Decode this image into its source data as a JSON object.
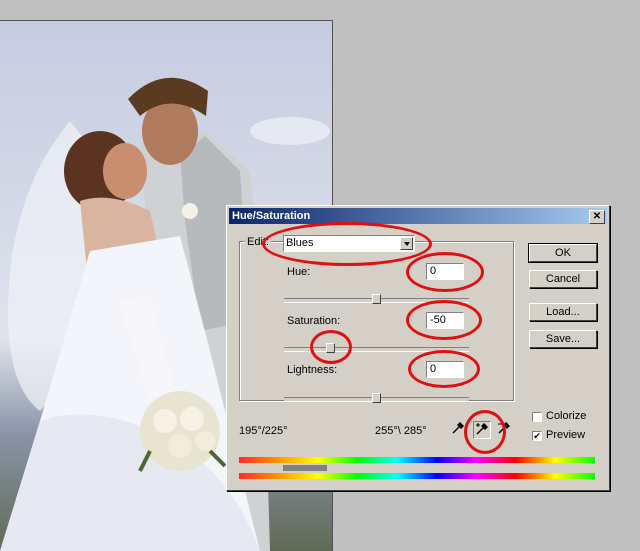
{
  "dialog": {
    "title": "Hue/Saturation",
    "close_glyph": "✕",
    "edit": {
      "label": "Edit:",
      "value": "Blues"
    },
    "hue": {
      "label": "Hue:",
      "value": "0",
      "slider_fraction": 0.5
    },
    "saturation": {
      "label": "Saturation:",
      "value": "-50",
      "slider_fraction": 0.25
    },
    "lightness": {
      "label": "Lightness:",
      "value": "0",
      "slider_fraction": 0.5
    },
    "range_left": "195°/225°",
    "range_right": "255°\\ 285°",
    "buttons": {
      "ok": "OK",
      "cancel": "Cancel",
      "load": "Load...",
      "save": "Save..."
    },
    "colorize": {
      "label": "Colorize",
      "checked": false
    },
    "preview": {
      "label": "Preview",
      "checked": true
    },
    "tools": [
      "eyedropper-icon",
      "eyedropper-plus-icon",
      "eyedropper-minus-icon"
    ]
  },
  "annotation_color": "#e01010"
}
